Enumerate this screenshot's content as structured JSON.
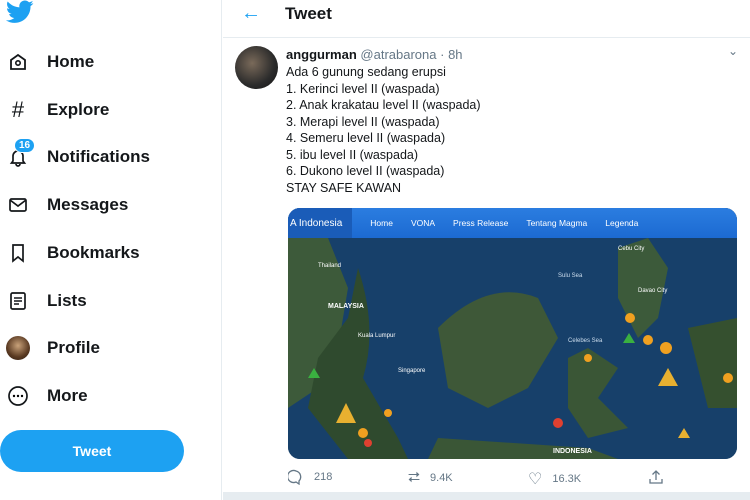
{
  "sidebar": {
    "items": [
      {
        "label": "Home",
        "icon": "home-icon"
      },
      {
        "label": "Explore",
        "icon": "hashtag-icon"
      },
      {
        "label": "Notifications",
        "icon": "bell-icon",
        "badge": "16"
      },
      {
        "label": "Messages",
        "icon": "envelope-icon"
      },
      {
        "label": "Bookmarks",
        "icon": "bookmark-icon"
      },
      {
        "label": "Lists",
        "icon": "list-icon"
      },
      {
        "label": "Profile",
        "icon": "avatar"
      },
      {
        "label": "More",
        "icon": "more-icon"
      }
    ],
    "tweet_button": "Tweet"
  },
  "header": {
    "title": "Tweet"
  },
  "tweet": {
    "display_name": "anggurman",
    "handle": "@atrabarona",
    "time": "· 8h",
    "lines": [
      "Ada 6 gunung sedang erupsi",
      "1. Kerinci level II (waspada)",
      "2. Anak krakatau level II (waspada)",
      "3. Merapi level II (waspada)",
      "4. Semeru level II (waspada)",
      "5. ibu level II (waspada)",
      "6. Dukono level II (waspada)",
      "STAY SAFE KAWAN"
    ],
    "media": {
      "nav": [
        "A Indonesia",
        "Home",
        "VONA",
        "Press Release",
        "Tentang Magma",
        "Legenda"
      ],
      "labels": [
        "MALAYSIA",
        "Singapore",
        "INDONESIA",
        "Sulu Sea",
        "Celebes Sea",
        "Davao City",
        "Cebu City",
        "Thailand",
        "Kuala Lumpur"
      ]
    },
    "replies": "218",
    "retweets": "9.4K",
    "likes": "16.3K"
  },
  "colors": {
    "accent": "#1da1f2"
  }
}
